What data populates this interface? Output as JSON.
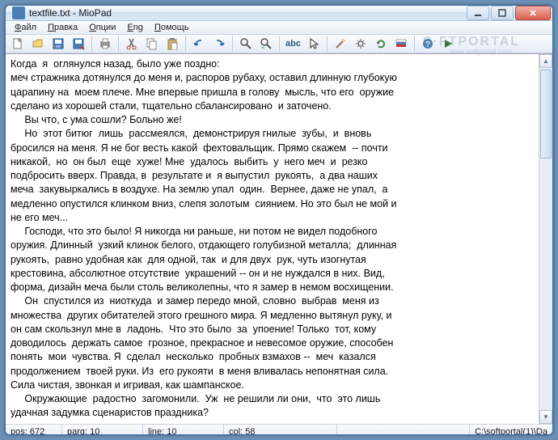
{
  "title": "textfile.txt - MioPad",
  "menu": {
    "file": "Файл",
    "edit": "Правка",
    "options": "Опции",
    "eng": "Eng",
    "help": "Помощь"
  },
  "toolbar": {
    "abc": "abc",
    "icons": {
      "new": "new-icon",
      "open": "open-icon",
      "save": "save-icon",
      "saveas": "saveas-icon",
      "print": "print-icon",
      "cut": "cut-icon",
      "copy": "copy-icon",
      "paste": "paste-icon",
      "undo": "undo-icon",
      "redo": "redo-icon",
      "find": "find-icon",
      "replace": "replace-icon",
      "spell": "spell-icon",
      "cursor": "cursor-icon",
      "wand": "wand-icon",
      "settings": "settings-icon",
      "refresh": "refresh-icon",
      "flag": "flag-icon",
      "help": "help-icon",
      "run": "run-icon"
    }
  },
  "watermark": "S·FTPORTAL",
  "watermark_sub": "www.softportal.com",
  "content": "Когда  я  оглянулся назад, было уже поздно:\nмеч стражника дотянулся до меня и, распоров рубаху, оставил длинную глубокую\nцарапину на  моем плече. Мне впервые пришла в голову  мысль, что его  оружие\nсделано из хорошей стали, тщательно сбалансировано  и заточено.\n     Вы что, с ума сошли? Больно же!\n     Но  этот битюг  лишь  рассмеялся,  демонстрируя гнилые  зубы,  и  вновь\nбросился на меня. Я не бог весть какой  фехтовальщик. Прямо скажем  -- почти\nникакой,  но  он был  еще  хуже! Мне  удалось  выбить  у  него меч  и  резко\nподбросить вверх. Правда, в  результате и  я выпустил  рукоять,  а два наших\nмеча  закувыркались в воздухе. На землю упал  один.  Вернее, даже не упал,  а\nмедленно опустился клинком вниз, слепя золотым  сиянием. Но это был не мой и\nне его меч...\n     Господи, что это было! Я никогда ни раньше, ни потом не видел подобного\nоружия. Длинный  узкий клинок белого, отдающего голубизной металла;  длинная\nрукоять,  равно удобная как  для одной, так  и для двух  рук, чуть изогнутая\nкрестовина, абсолютное отсутствие  украшений -- он и не нуждался в них. Вид,\nформа, дизайн меча были столь великолепны, что я замер в немом восхищении.\n     Он  спустился из  ниоткуда  и замер передо мной, словно  выбрав  меня из\nмножества  других обитателей этого грешного мира. Я медленно вытянул руку, и\nон сам скользнул мне в  ладонь.  Что это было  за  упоение! Только  тот, кому\nдоводилось  держать самое  грозное, прекрасное и невесомое оружие, способен\nпонять  мои  чувства. Я  сделал  несколько  пробных взмахов --  меч  казался\nпродолжением  твоей руки. Из  его рукояти  в меня вливалась непонятная сила.\nСила чистая, звонкая и игривая, как шампанское.\n     Окружающие  радостно  загомонили.  Уж  не решили ли они,  что  это лишь\nудачная задумка сценаристов праздника?",
  "status": {
    "pos_label": "pos:",
    "pos_val": "672",
    "parg_label": "parg:",
    "parg_val": "10",
    "line_label": "line:",
    "line_val": "10",
    "col_label": "col:",
    "col_val": "58",
    "path": "C:\\softportal(1)\\Da"
  }
}
